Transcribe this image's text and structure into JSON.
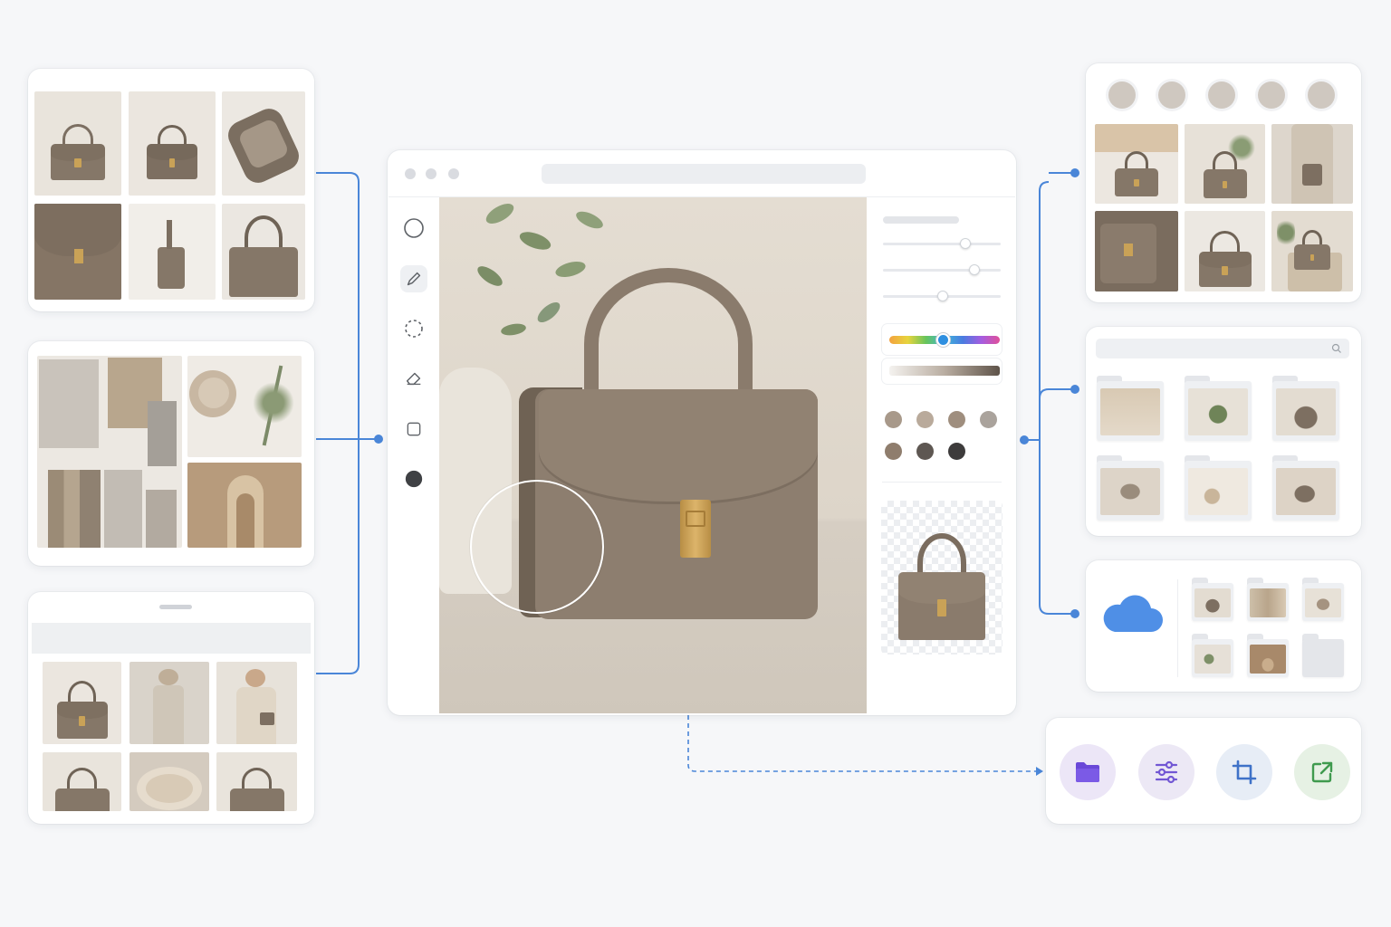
{
  "diagram": {
    "accent_color": "#4a86d8",
    "workflow_icons": [
      "folder-icon",
      "sliders-icon",
      "crop-icon",
      "export-icon"
    ],
    "editor_tools": [
      "circle-select-icon",
      "brush-icon",
      "lasso-icon",
      "eraser-icon",
      "rectangle-icon",
      "fill-icon"
    ],
    "palette_colors": [
      "#a8998a",
      "#b9aa9b",
      "#9f8e7e",
      "#aaa39c",
      "#8f7d6d",
      "#5e5752",
      "#3d3b3b"
    ],
    "swatch_colors": [
      "#cfc8c0",
      "#cfc8c0",
      "#cfc8c0",
      "#cfc8c0",
      "#cfc8c0"
    ],
    "cloud_color": "#4f8fe6"
  }
}
